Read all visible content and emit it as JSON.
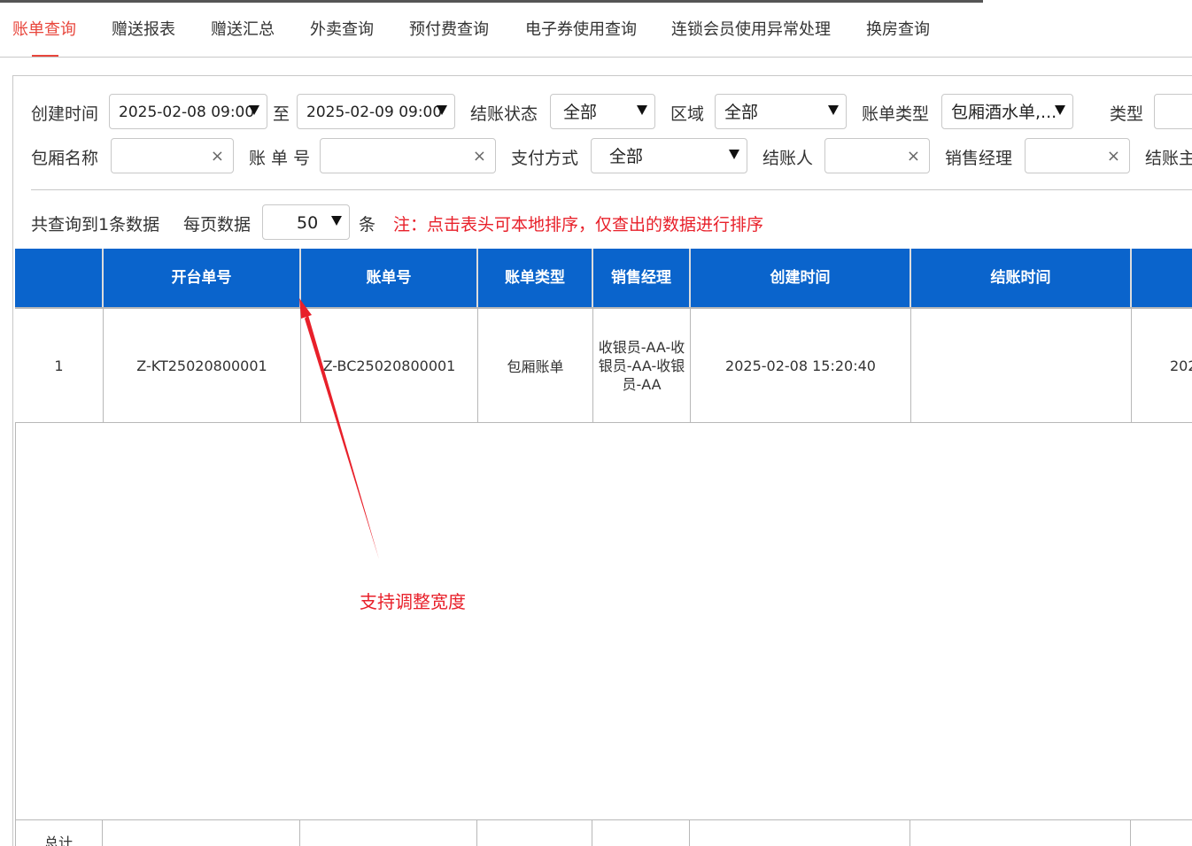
{
  "tabs": [
    {
      "label": "账单查询",
      "active": true
    },
    {
      "label": "赠送报表"
    },
    {
      "label": "赠送汇总"
    },
    {
      "label": "外卖查询"
    },
    {
      "label": "预付费查询"
    },
    {
      "label": "电子券使用查询"
    },
    {
      "label": "连锁会员使用异常处理"
    },
    {
      "label": "换房查询"
    }
  ],
  "filters": {
    "create_time_label": "创建时间",
    "start_time": "2025-02-08 09:00",
    "to_label": "至",
    "end_time": "2025-02-09 09:00",
    "settle_status_label": "结账状态",
    "settle_status_value": "全部",
    "area_label": "区域",
    "area_value": "全部",
    "bill_type_label": "账单类型",
    "bill_type_value": "包厢酒水单,...",
    "type_label": "类型",
    "room_name_label": "包厢名称",
    "bill_no_label": "账 单 号",
    "pay_method_label": "支付方式",
    "pay_method_value": "全部",
    "settler_label": "结账人",
    "sales_manager_label": "销售经理",
    "settle_subject_label": "结账主",
    "clear_icon": "×"
  },
  "summary": {
    "total_text": "共查询到1条数据",
    "page_size_label": "每页数据",
    "page_size_value": "50",
    "unit": "条",
    "note": "注：点击表头可本地排序，仅查出的数据进行排序"
  },
  "table": {
    "columns": [
      "",
      "开台单号",
      "账单号",
      "账单类型",
      "销售经理",
      "创建时间",
      "结账时间",
      ""
    ],
    "rows": [
      [
        "1",
        "Z-KT25020800001",
        "Z-BC25020800001",
        "包厢账单",
        "收银员-AA-收银员-AA-收银员-AA",
        "2025-02-08 15:20:40",
        "",
        "202"
      ]
    ],
    "footer_label": "总计"
  },
  "annotation": {
    "text": "支持调整宽度",
    "color": "#e8202a"
  },
  "colors": {
    "accent": "#e8463c",
    "header_bg": "#0a64cc"
  }
}
